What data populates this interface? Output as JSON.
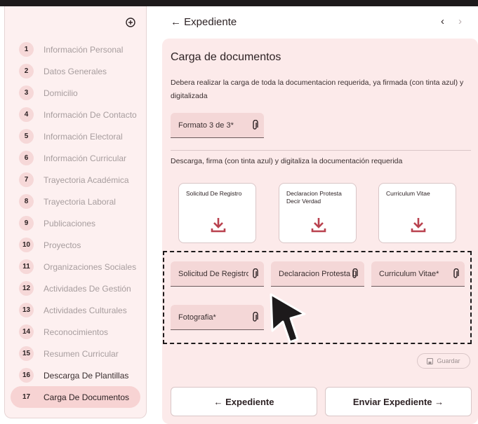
{
  "colors": {
    "accent": "#b9424f",
    "surface": "#fceaea",
    "sidebar_bg": "#fdf0f0",
    "field_bg": "#f4d7d7"
  },
  "sidebar": {
    "add_icon": "add-circle-icon",
    "items": [
      {
        "num": "1",
        "label": "Información Personal"
      },
      {
        "num": "2",
        "label": "Datos Generales"
      },
      {
        "num": "3",
        "label": "Domicilio"
      },
      {
        "num": "4",
        "label": "Información De Contacto"
      },
      {
        "num": "5",
        "label": "Información Electoral"
      },
      {
        "num": "6",
        "label": "Información Curricular"
      },
      {
        "num": "7",
        "label": "Trayectoria Académica"
      },
      {
        "num": "8",
        "label": "Trayectoria Laboral"
      },
      {
        "num": "9",
        "label": "Publicaciones"
      },
      {
        "num": "10",
        "label": "Proyectos"
      },
      {
        "num": "11",
        "label": "Organizaciones Sociales"
      },
      {
        "num": "12",
        "label": "Actividades De Gestión"
      },
      {
        "num": "13",
        "label": "Actividades Culturales"
      },
      {
        "num": "14",
        "label": "Reconocimientos"
      },
      {
        "num": "15",
        "label": "Resumen Curricular"
      },
      {
        "num": "16",
        "label": "Descarga De Plantillas"
      },
      {
        "num": "17",
        "label": "Carga De Documentos"
      }
    ]
  },
  "header": {
    "back_label": "← Expediente",
    "prev": "‹",
    "next": "›"
  },
  "main": {
    "title": "Carga de documentos",
    "description": "Debera realizar la carga de toda la documentacion requerida, ya firmada (con tinta azul) y digitalizada",
    "formato_field": "Formato 3 de 3*",
    "download_desc": "Descarga, firma (con tinta azul) y digitaliza la documentación requerida",
    "templates": [
      {
        "label": "Solicitud De Registro",
        "icon": "download-icon"
      },
      {
        "label": "Declaracion Protesta Decir Verdad",
        "icon": "download-icon"
      },
      {
        "label": "Curriculum Vitae",
        "icon": "download-icon"
      }
    ],
    "upload_fields": [
      {
        "label": "Solicitud De Registro*",
        "icon": "paperclip-icon"
      },
      {
        "label": "Declaracion Protesta Decir Verdad*",
        "icon": "paperclip-icon"
      },
      {
        "label": "Curriculum Vitae*",
        "icon": "paperclip-icon"
      },
      {
        "label": "Fotografia*",
        "icon": "paperclip-icon"
      }
    ],
    "save_label": "Guardar",
    "footer_back": "← Expediente",
    "footer_submit": "Enviar Expediente →"
  }
}
